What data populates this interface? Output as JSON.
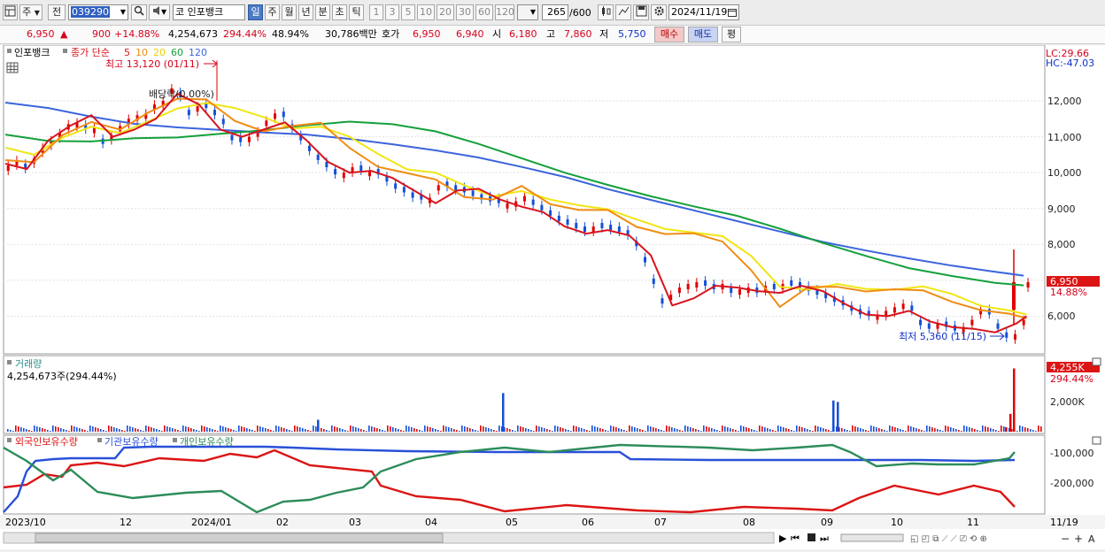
{
  "toolbar": {
    "mode_label": "주",
    "prev_label": "전",
    "code": "039290",
    "market": "코",
    "name": "인포뱅크",
    "period_tabs": [
      "일",
      "주",
      "월",
      "년",
      "분",
      "초",
      "틱"
    ],
    "active_period": "일",
    "interval_buttons": [
      "1",
      "3",
      "5",
      "10",
      "20",
      "30",
      "60",
      "120"
    ],
    "count": "265",
    "count_max": "/600",
    "date": "2024/11/19"
  },
  "quote": {
    "price": "6,950",
    "change_sign": "▲",
    "change": "900",
    "change_pct": "+14.88%",
    "volume": "4,254,673",
    "volume_ratio": "294.44%",
    "turnover": "48.94%",
    "amount": "30,786백만",
    "ask_label": "호가",
    "ask1": "6,950",
    "bid1": "6,940",
    "open_label": "시",
    "open": "6,180",
    "high_label": "고",
    "high": "7,860",
    "low_label": "저",
    "low": "5,750",
    "buy_label": "매수",
    "sell_label": "매도",
    "eval_label": "평"
  },
  "price_panel": {
    "legend_name": "인포뱅크",
    "legend_ma": "종가 단순",
    "ma_periods": [
      "5",
      "10",
      "20",
      "60",
      "120"
    ],
    "max_note": "최고 13,120 (01/11)",
    "min_note": "최저 5,360 (11/15)",
    "dividend_note": "배당락(0.00%)",
    "lc": "LC:29.66",
    "hc": "HC:-47.03",
    "last_price_tag": "6,950",
    "last_pct_tag": "14.88%",
    "y_ticks": [
      "12,000",
      "11,000",
      "10,000",
      "9,000",
      "8,000",
      "7,000",
      "6,000"
    ]
  },
  "volume_panel": {
    "title": "거래량",
    "value": "4,254,673주(294.44%)",
    "last_tag": "4,255K",
    "last_pct": "294.44%",
    "y_ticks": [
      "2,000K"
    ]
  },
  "holding_panel": {
    "legend": [
      "외국인보유수량",
      "기관보유수량",
      "개인보유수량"
    ],
    "y_ticks": [
      "-100,000",
      "-200,000"
    ]
  },
  "x_ticks": [
    "2023/10",
    "12",
    "2024/01",
    "02",
    "03",
    "04",
    "05",
    "06",
    "07",
    "08",
    "09",
    "10",
    "11",
    "11/19"
  ],
  "colors": {
    "up": "#e00000",
    "down": "#1450d8",
    "ma5": "#d8141c",
    "ma10": "#f08c14",
    "ma20": "#f0e614",
    "ma60": "#14a03c",
    "ma120": "#3c64dc",
    "foreign": "#2c8c5a",
    "institution": "#2850d8",
    "individual": "#dc1414"
  },
  "chart_data": {
    "type": "candlestick",
    "x_start": "2023/10",
    "x_end": "2024/11/19",
    "ylim": [
      5200,
      13300
    ],
    "ma120": [
      [
        0,
        11950
      ],
      [
        30,
        11800
      ],
      [
        60,
        11560
      ],
      [
        90,
        11360
      ],
      [
        120,
        11260
      ],
      [
        150,
        11190
      ],
      [
        180,
        11120
      ],
      [
        210,
        11060
      ],
      [
        240,
        10940
      ],
      [
        270,
        10790
      ],
      [
        300,
        10620
      ],
      [
        330,
        10420
      ],
      [
        360,
        10160
      ],
      [
        390,
        9880
      ],
      [
        420,
        9540
      ],
      [
        450,
        9240
      ],
      [
        480,
        8950
      ],
      [
        510,
        8650
      ],
      [
        540,
        8360
      ],
      [
        570,
        8070
      ],
      [
        600,
        7830
      ],
      [
        630,
        7610
      ],
      [
        660,
        7410
      ],
      [
        690,
        7240
      ],
      [
        710,
        7130
      ]
    ],
    "ma60": [
      [
        0,
        11060
      ],
      [
        30,
        10880
      ],
      [
        60,
        10870
      ],
      [
        90,
        10960
      ],
      [
        120,
        10980
      ],
      [
        150,
        11080
      ],
      [
        180,
        11180
      ],
      [
        210,
        11320
      ],
      [
        240,
        11420
      ],
      [
        270,
        11350
      ],
      [
        300,
        11150
      ],
      [
        330,
        10800
      ],
      [
        360,
        10400
      ],
      [
        390,
        10000
      ],
      [
        420,
        9660
      ],
      [
        450,
        9340
      ],
      [
        480,
        9060
      ],
      [
        510,
        8800
      ],
      [
        540,
        8440
      ],
      [
        570,
        8040
      ],
      [
        600,
        7680
      ],
      [
        630,
        7340
      ],
      [
        660,
        7120
      ],
      [
        690,
        6930
      ],
      [
        710,
        6860
      ]
    ],
    "ma20": [
      [
        0,
        10700
      ],
      [
        20,
        10500
      ],
      [
        40,
        10980
      ],
      [
        60,
        11280
      ],
      [
        80,
        11100
      ],
      [
        100,
        11430
      ],
      [
        120,
        11790
      ],
      [
        140,
        11940
      ],
      [
        160,
        11800
      ],
      [
        180,
        11550
      ],
      [
        200,
        11230
      ],
      [
        220,
        11280
      ],
      [
        240,
        11000
      ],
      [
        260,
        10520
      ],
      [
        280,
        10090
      ],
      [
        300,
        10000
      ],
      [
        320,
        9650
      ],
      [
        340,
        9340
      ],
      [
        360,
        9490
      ],
      [
        380,
        9250
      ],
      [
        400,
        9090
      ],
      [
        420,
        8980
      ],
      [
        440,
        8700
      ],
      [
        460,
        8430
      ],
      [
        480,
        8330
      ],
      [
        500,
        8230
      ],
      [
        520,
        7680
      ],
      [
        540,
        6820
      ],
      [
        560,
        6740
      ],
      [
        580,
        6900
      ],
      [
        600,
        6760
      ],
      [
        620,
        6740
      ],
      [
        640,
        6830
      ],
      [
        660,
        6620
      ],
      [
        680,
        6290
      ],
      [
        700,
        6160
      ],
      [
        712,
        6050
      ]
    ],
    "ma10": [
      [
        0,
        10350
      ],
      [
        20,
        10290
      ],
      [
        40,
        11050
      ],
      [
        60,
        11410
      ],
      [
        80,
        11200
      ],
      [
        100,
        11680
      ],
      [
        120,
        12060
      ],
      [
        140,
        12040
      ],
      [
        160,
        11440
      ],
      [
        180,
        11150
      ],
      [
        200,
        11300
      ],
      [
        220,
        11390
      ],
      [
        240,
        10690
      ],
      [
        260,
        10160
      ],
      [
        280,
        9990
      ],
      [
        300,
        9810
      ],
      [
        320,
        9320
      ],
      [
        340,
        9250
      ],
      [
        360,
        9630
      ],
      [
        380,
        9120
      ],
      [
        400,
        8960
      ],
      [
        420,
        8960
      ],
      [
        440,
        8490
      ],
      [
        460,
        8290
      ],
      [
        480,
        8310
      ],
      [
        500,
        8080
      ],
      [
        520,
        7280
      ],
      [
        540,
        6260
      ],
      [
        560,
        6820
      ],
      [
        580,
        6820
      ],
      [
        600,
        6690
      ],
      [
        620,
        6750
      ],
      [
        640,
        6720
      ],
      [
        660,
        6400
      ],
      [
        680,
        6170
      ],
      [
        700,
        6070
      ],
      [
        712,
        5940
      ]
    ],
    "ma5": [
      [
        0,
        10250
      ],
      [
        15,
        10100
      ],
      [
        30,
        10900
      ],
      [
        45,
        11300
      ],
      [
        60,
        11600
      ],
      [
        75,
        11000
      ],
      [
        90,
        11200
      ],
      [
        105,
        11500
      ],
      [
        120,
        12200
      ],
      [
        135,
        11900
      ],
      [
        150,
        11200
      ],
      [
        165,
        11000
      ],
      [
        180,
        11200
      ],
      [
        195,
        11400
      ],
      [
        210,
        10900
      ],
      [
        225,
        10300
      ],
      [
        240,
        10000
      ],
      [
        255,
        10050
      ],
      [
        270,
        9850
      ],
      [
        285,
        9500
      ],
      [
        300,
        9150
      ],
      [
        315,
        9500
      ],
      [
        330,
        9550
      ],
      [
        345,
        9250
      ],
      [
        360,
        9050
      ],
      [
        375,
        8900
      ],
      [
        390,
        8500
      ],
      [
        405,
        8300
      ],
      [
        420,
        8400
      ],
      [
        435,
        8250
      ],
      [
        450,
        7700
      ],
      [
        465,
        6300
      ],
      [
        480,
        6500
      ],
      [
        495,
        6850
      ],
      [
        510,
        6800
      ],
      [
        525,
        6700
      ],
      [
        540,
        6650
      ],
      [
        555,
        6850
      ],
      [
        570,
        6700
      ],
      [
        585,
        6350
      ],
      [
        600,
        6050
      ],
      [
        615,
        6000
      ],
      [
        630,
        6150
      ],
      [
        645,
        5850
      ],
      [
        660,
        5700
      ],
      [
        675,
        5650
      ],
      [
        690,
        5550
      ],
      [
        705,
        5800
      ],
      [
        712,
        6000
      ]
    ],
    "candles": [
      [
        2,
        10200
      ],
      [
        8,
        10350
      ],
      [
        14,
        10100
      ],
      [
        20,
        10400
      ],
      [
        26,
        10700
      ],
      [
        32,
        10900
      ],
      [
        38,
        11100
      ],
      [
        44,
        11350
      ],
      [
        50,
        11400
      ],
      [
        56,
        11200
      ],
      [
        62,
        11250
      ],
      [
        68,
        10800
      ],
      [
        74,
        11050
      ],
      [
        80,
        11300
      ],
      [
        86,
        11500
      ],
      [
        92,
        11600
      ],
      [
        98,
        11650
      ],
      [
        104,
        11900
      ],
      [
        110,
        12000
      ],
      [
        116,
        12350
      ],
      [
        122,
        12100
      ],
      [
        128,
        11600
      ],
      [
        134,
        11850
      ],
      [
        140,
        11800
      ],
      [
        146,
        11600
      ],
      [
        152,
        11350
      ],
      [
        158,
        10900
      ],
      [
        164,
        10850
      ],
      [
        170,
        11000
      ],
      [
        176,
        11150
      ],
      [
        182,
        11450
      ],
      [
        188,
        11650
      ],
      [
        194,
        11550
      ],
      [
        200,
        11200
      ],
      [
        206,
        10900
      ],
      [
        212,
        10600
      ],
      [
        218,
        10350
      ],
      [
        224,
        10150
      ],
      [
        230,
        9950
      ],
      [
        236,
        10000
      ],
      [
        242,
        10150
      ],
      [
        248,
        10050
      ],
      [
        254,
        10050
      ],
      [
        260,
        9950
      ],
      [
        266,
        9750
      ],
      [
        272,
        9550
      ],
      [
        278,
        9450
      ],
      [
        284,
        9300
      ],
      [
        290,
        9250
      ],
      [
        296,
        9300
      ],
      [
        302,
        9650
      ],
      [
        308,
        9600
      ],
      [
        314,
        9500
      ],
      [
        320,
        9450
      ],
      [
        326,
        9350
      ],
      [
        332,
        9250
      ],
      [
        338,
        9200
      ],
      [
        344,
        9150
      ],
      [
        350,
        9150
      ],
      [
        356,
        9200
      ],
      [
        362,
        9350
      ],
      [
        368,
        9100
      ],
      [
        374,
        8950
      ],
      [
        380,
        8800
      ],
      [
        386,
        8650
      ],
      [
        392,
        8550
      ],
      [
        398,
        8450
      ],
      [
        404,
        8350
      ],
      [
        410,
        8500
      ],
      [
        416,
        8450
      ],
      [
        422,
        8400
      ],
      [
        428,
        8350
      ],
      [
        434,
        8250
      ],
      [
        440,
        7950
      ],
      [
        446,
        7500
      ],
      [
        452,
        6900
      ],
      [
        458,
        6350
      ],
      [
        464,
        6600
      ],
      [
        470,
        6800
      ],
      [
        476,
        6900
      ],
      [
        482,
        6950
      ],
      [
        488,
        6850
      ],
      [
        494,
        6750
      ],
      [
        500,
        6900
      ],
      [
        506,
        6650
      ],
      [
        512,
        6750
      ],
      [
        518,
        6800
      ],
      [
        524,
        6650
      ],
      [
        530,
        6850
      ],
      [
        536,
        6750
      ],
      [
        542,
        6900
      ],
      [
        548,
        6850
      ],
      [
        554,
        6800
      ],
      [
        560,
        6700
      ],
      [
        566,
        6600
      ],
      [
        572,
        6500
      ],
      [
        578,
        6400
      ],
      [
        584,
        6300
      ],
      [
        590,
        6150
      ],
      [
        596,
        6050
      ],
      [
        602,
        6000
      ],
      [
        608,
        6050
      ],
      [
        614,
        6150
      ],
      [
        620,
        6250
      ],
      [
        626,
        6350
      ],
      [
        632,
        6150
      ],
      [
        638,
        5750
      ],
      [
        644,
        5650
      ],
      [
        650,
        5800
      ],
      [
        656,
        5700
      ],
      [
        662,
        5600
      ],
      [
        668,
        5700
      ],
      [
        674,
        5900
      ],
      [
        680,
        6200
      ],
      [
        686,
        6050
      ],
      [
        692,
        5650
      ],
      [
        698,
        5400
      ],
      [
        704,
        5500
      ],
      [
        710,
        5900
      ],
      [
        713,
        6950
      ]
    ],
    "volume_spikes": [
      [
        567,
        2600
      ],
      [
        940,
        2100
      ],
      [
        945,
        2000
      ],
      [
        1140,
        1200
      ],
      [
        1144,
        4255
      ],
      [
        1135,
        300
      ],
      [
        358,
        800
      ]
    ]
  }
}
